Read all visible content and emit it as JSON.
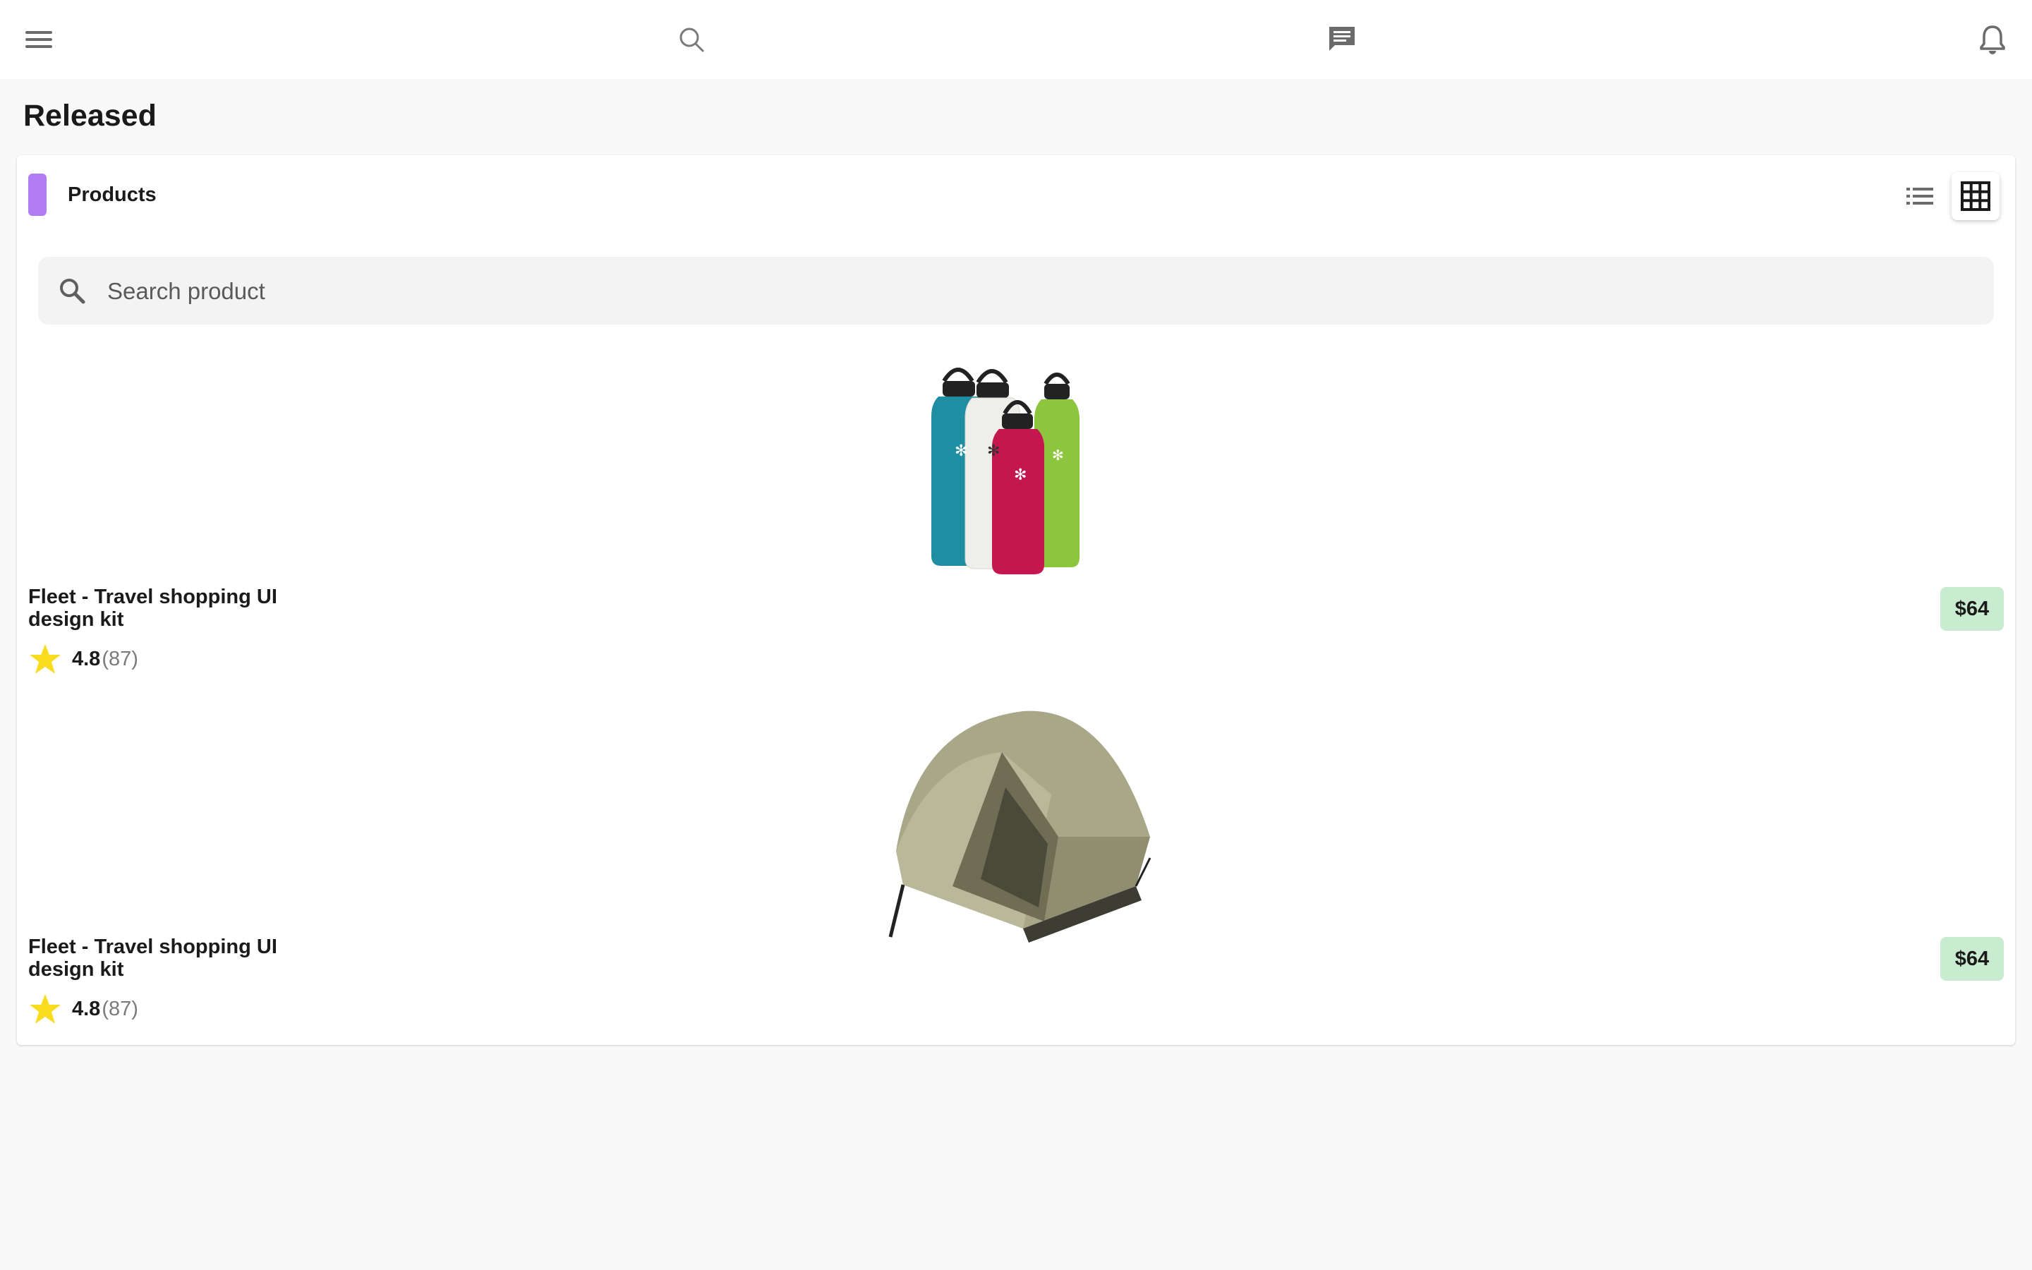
{
  "page": {
    "title": "Released"
  },
  "topbar": {
    "menu_icon": "menu-icon",
    "search_icon": "search-icon",
    "chat_icon": "chat-icon",
    "bell_icon": "bell-icon"
  },
  "products_card": {
    "title": "Products",
    "accent_color": "#b27cf5",
    "view_list_icon": "list-view-icon",
    "view_grid_icon": "grid-view-icon",
    "active_view": "grid",
    "search_placeholder": "Search product"
  },
  "products": [
    {
      "name": "Fleet - Travel shopping UI design kit",
      "price": "$64",
      "rating": "4.8",
      "reviews": "(87)",
      "image": "water-bottles"
    },
    {
      "name": "Fleet - Travel shopping UI design kit",
      "price": "$64",
      "rating": "4.8",
      "reviews": "(87)",
      "image": "tent"
    }
  ],
  "colors": {
    "price_badge_bg": "#c9ecd0",
    "star": "#f9dc1f",
    "background": "#f9f9f9"
  }
}
